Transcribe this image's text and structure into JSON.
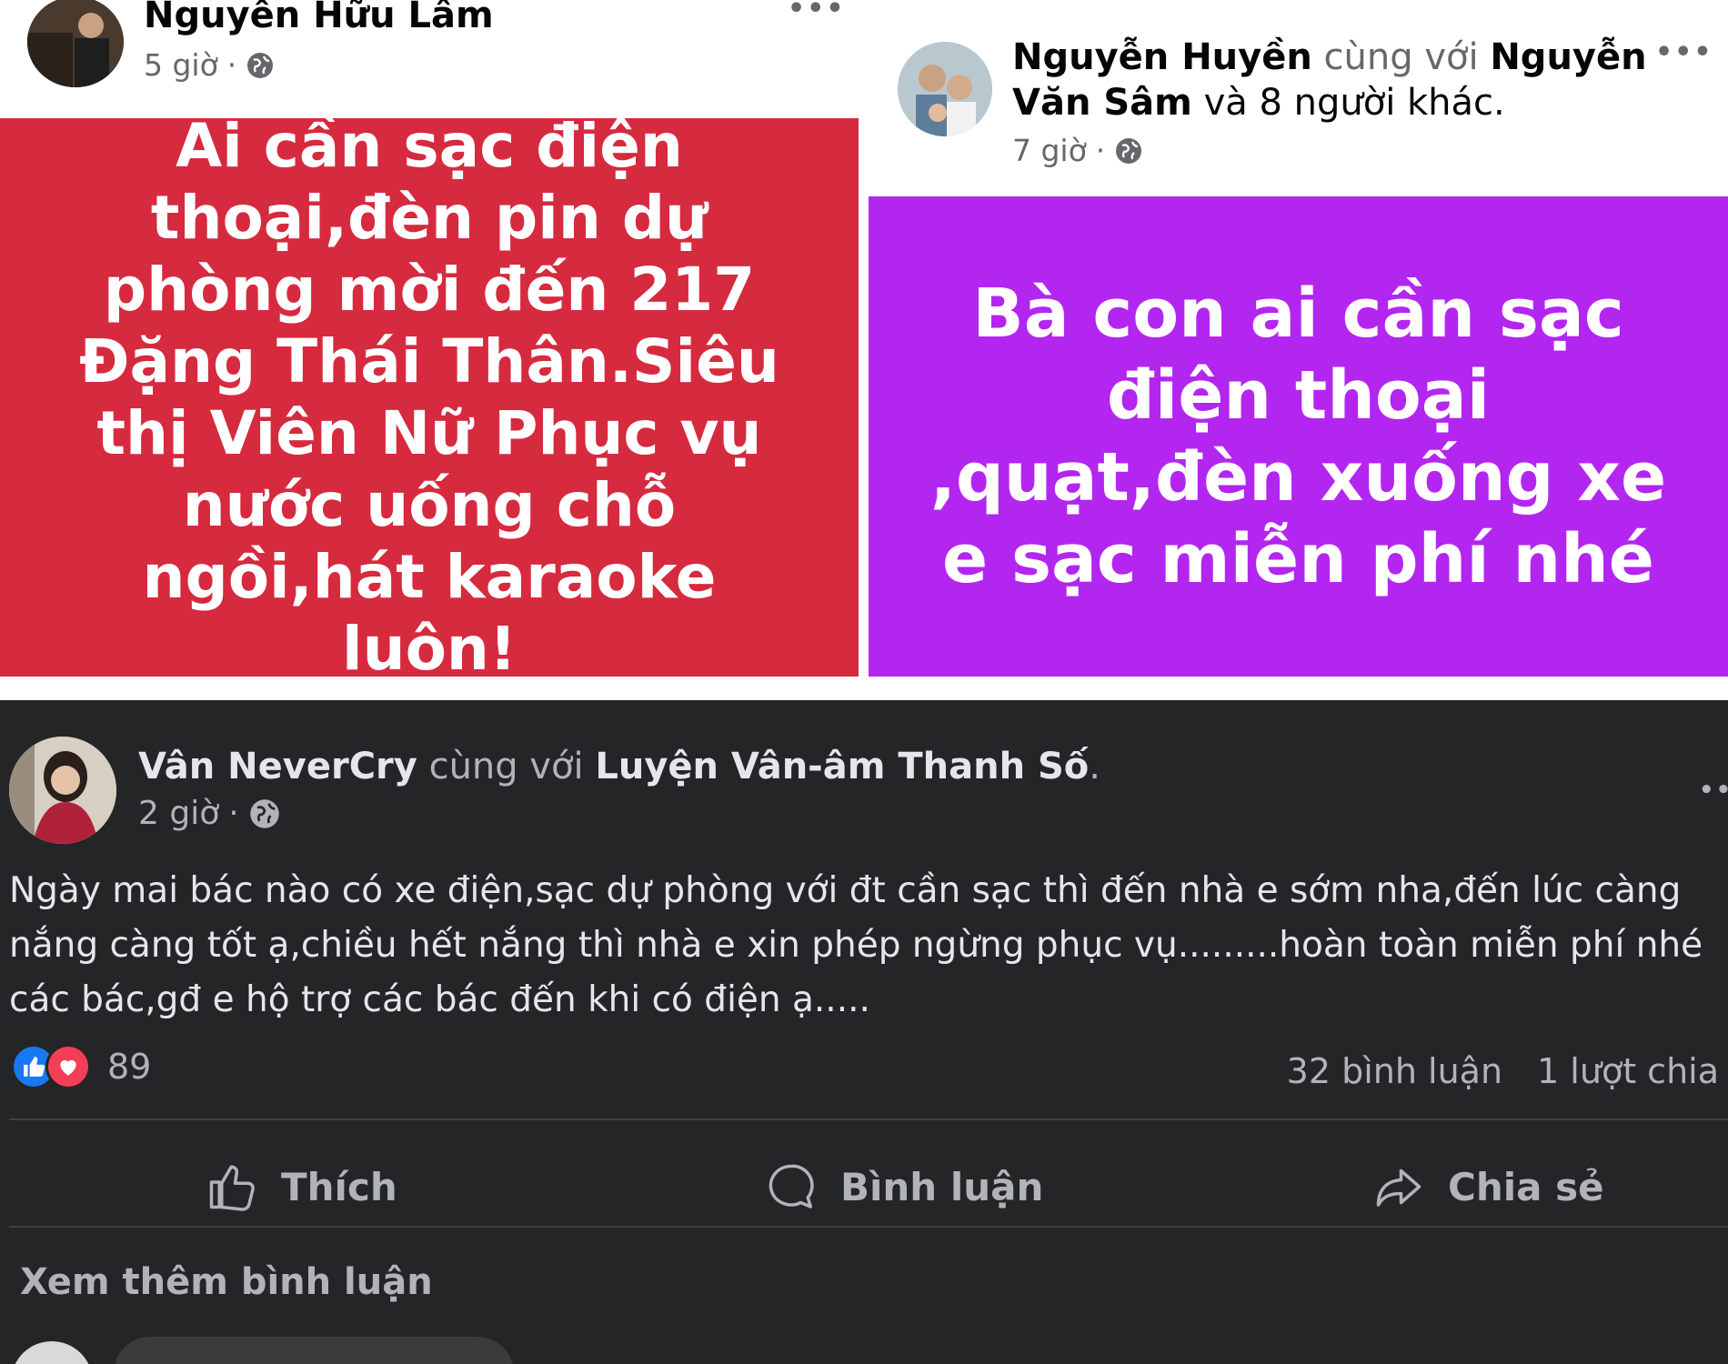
{
  "post1": {
    "author": "Nguyễn Hữu Lâm",
    "time": "5 giờ",
    "separator": "·",
    "more": "•••",
    "text": "Ai cần sạc điện thoại,đèn pin dự phòng mời đến 217 Đặng Thái Thân.Siêu thị Viên Nữ Phục vụ nước uống chỗ ngồi,hát karaoke luôn!",
    "background_color": "#d62a3f"
  },
  "post2": {
    "author": "Nguyễn Huyền",
    "with_word": "cùng với",
    "tagged": "Nguyễn Văn Sâm",
    "and_others": "và 8 người khác.",
    "time": "7 giờ",
    "separator": "·",
    "more": "•••",
    "text": "Bà con ai cần sạc điện thoại ,quạt,đèn xuống xe e sạc miễn phí nhé",
    "background_color": "#b326f0"
  },
  "post3": {
    "author": "Vân NeverCry",
    "with_word": "cùng với",
    "tagged": "Luyện Vân-âm Thanh Số",
    "period": ".",
    "time": "2 giờ",
    "separator": "·",
    "more": "••",
    "body_lines": [
      "Ngày mai bác nào có xe điện,sạc dự phòng với đt cần sạc thì đến nhà e sớm nha,đến lúc càng",
      "nắng càng tốt ạ,chiều hết nắng thì nhà e xin phép ngừng phục vụ.........hoàn toàn miễn phí nhé",
      "các bác,gđ e hộ trợ các bác đến khi có điện ạ....."
    ],
    "reaction_icons": [
      "like-icon",
      "love-icon"
    ],
    "reaction_count": "89",
    "comments": "32 bình luận",
    "shares": "1 lượt chia",
    "actions": {
      "like": "Thích",
      "comment": "Bình luận",
      "share": "Chia sẻ"
    },
    "see_more_comments": "Xem thêm bình luận"
  }
}
